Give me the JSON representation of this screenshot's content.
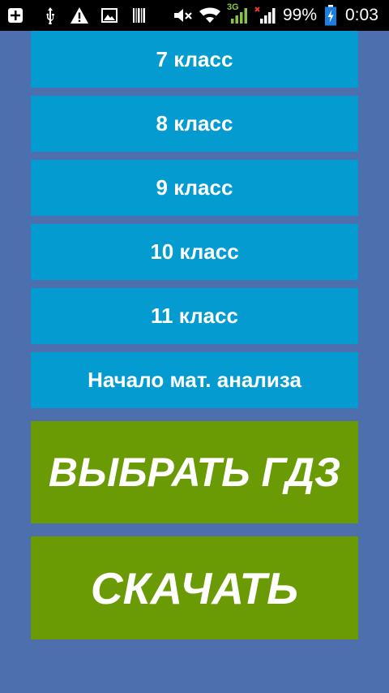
{
  "status_bar": {
    "signal_label": "3G",
    "battery_percent": "99%",
    "time": "0:03",
    "icons": [
      "add-box-icon",
      "usb-icon",
      "warning-icon",
      "image-icon",
      "barcode-icon",
      "mute-icon",
      "wifi-icon",
      "signal-3g-icon",
      "signal-no-data-icon",
      "battery-charging-icon"
    ]
  },
  "grades": [
    {
      "label": "7 класс"
    },
    {
      "label": "8 класс"
    },
    {
      "label": "9 класс"
    },
    {
      "label": "10 класс"
    },
    {
      "label": "11 класс"
    },
    {
      "label": "Начало мат. анализа"
    }
  ],
  "actions": {
    "choose_label": "ВЫБРАТЬ ГДЗ",
    "download_label": "СКАЧАТЬ"
  },
  "colors": {
    "background": "#4d6fae",
    "list_button": "#039bd0",
    "action_button": "#6a9b04",
    "status_bar": "#000000",
    "battery_fill": "#1a7fe0",
    "signal_green": "#8bc34a",
    "signal_red": "#e53935"
  }
}
